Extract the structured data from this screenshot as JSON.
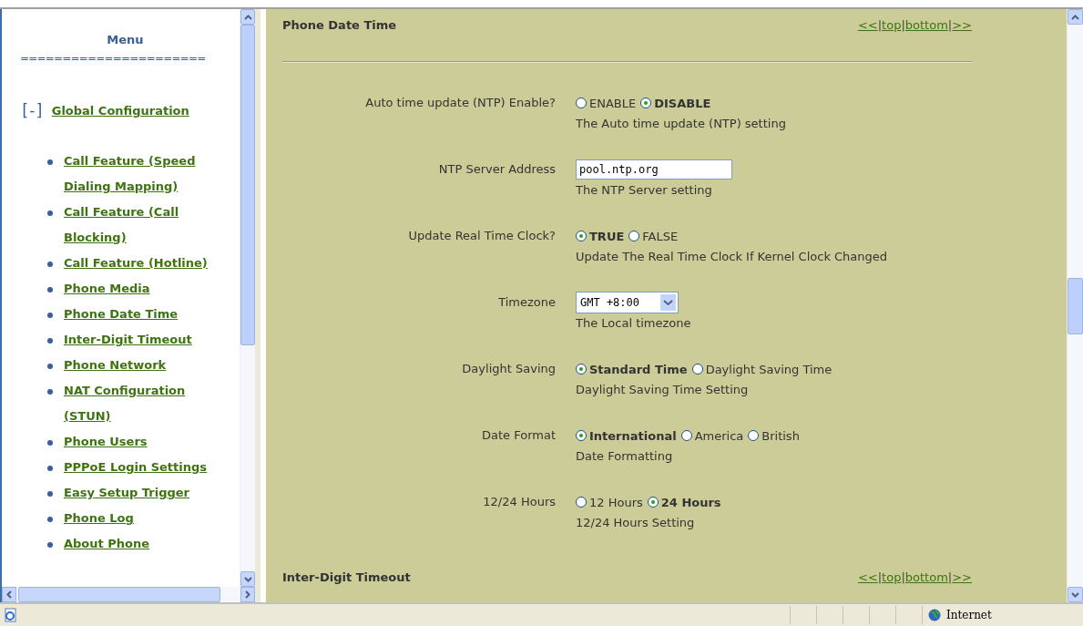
{
  "menu": {
    "title": "Menu",
    "divider": "======================",
    "group": {
      "toggle": "[-]",
      "label": "Global Configuration",
      "expanded": true,
      "items": [
        {
          "label": "Call Feature (Speed Dialing Mapping)"
        },
        {
          "label": "Call Feature (Call Blocking)"
        },
        {
          "label": "Call Feature (Hotline)"
        },
        {
          "label": "Phone Media"
        },
        {
          "label": "Phone Date Time"
        },
        {
          "label": "Inter-Digit Timeout"
        },
        {
          "label": "Phone Network"
        },
        {
          "label": "NAT Configuration (STUN)"
        },
        {
          "label": "Phone Users"
        },
        {
          "label": "PPPoE Login Settings"
        },
        {
          "label": "Easy Setup Trigger"
        },
        {
          "label": "Phone Log"
        },
        {
          "label": "About Phone"
        }
      ]
    }
  },
  "sections": [
    {
      "title": "Phone Date Time",
      "nav": [
        "<<",
        "top",
        "bottom",
        ">>"
      ],
      "separator": "|",
      "settings": [
        {
          "label": "Auto time update (NTP) Enable?",
          "kind": "radio",
          "options": [
            {
              "label": "ENABLE",
              "selected": false
            },
            {
              "label": "DISABLE",
              "selected": true
            }
          ],
          "description": "The Auto time update (NTP) setting"
        },
        {
          "label": "NTP Server Address",
          "kind": "text",
          "value": "pool.ntp.org",
          "description": "The NTP Server setting"
        },
        {
          "label": "Update Real Time Clock?",
          "kind": "radio",
          "options": [
            {
              "label": "TRUE",
              "selected": true
            },
            {
              "label": "FALSE",
              "selected": false
            }
          ],
          "description": "Update The Real Time Clock If Kernel Clock Changed"
        },
        {
          "label": "Timezone",
          "kind": "select",
          "value": "GMT +8:00",
          "description": "The Local timezone"
        },
        {
          "label": "Daylight Saving",
          "kind": "radio",
          "options": [
            {
              "label": "Standard Time",
              "selected": true
            },
            {
              "label": "Daylight Saving Time",
              "selected": false
            }
          ],
          "description": "Daylight Saving Time Setting"
        },
        {
          "label": "Date Format",
          "kind": "radio",
          "options": [
            {
              "label": "International",
              "selected": true
            },
            {
              "label": "America",
              "selected": false
            },
            {
              "label": "British",
              "selected": false
            }
          ],
          "description": "Date Formatting"
        },
        {
          "label": "12/24 Hours",
          "kind": "radio",
          "options": [
            {
              "label": "12 Hours",
              "selected": false
            },
            {
              "label": "24 Hours",
              "selected": true
            }
          ],
          "description": "12/24 Hours Setting"
        }
      ]
    },
    {
      "title": "Inter-Digit Timeout",
      "nav": [
        "<<",
        "top",
        "bottom",
        ">>"
      ],
      "separator": "|"
    }
  ],
  "status_bar": {
    "zone": "Internet"
  }
}
